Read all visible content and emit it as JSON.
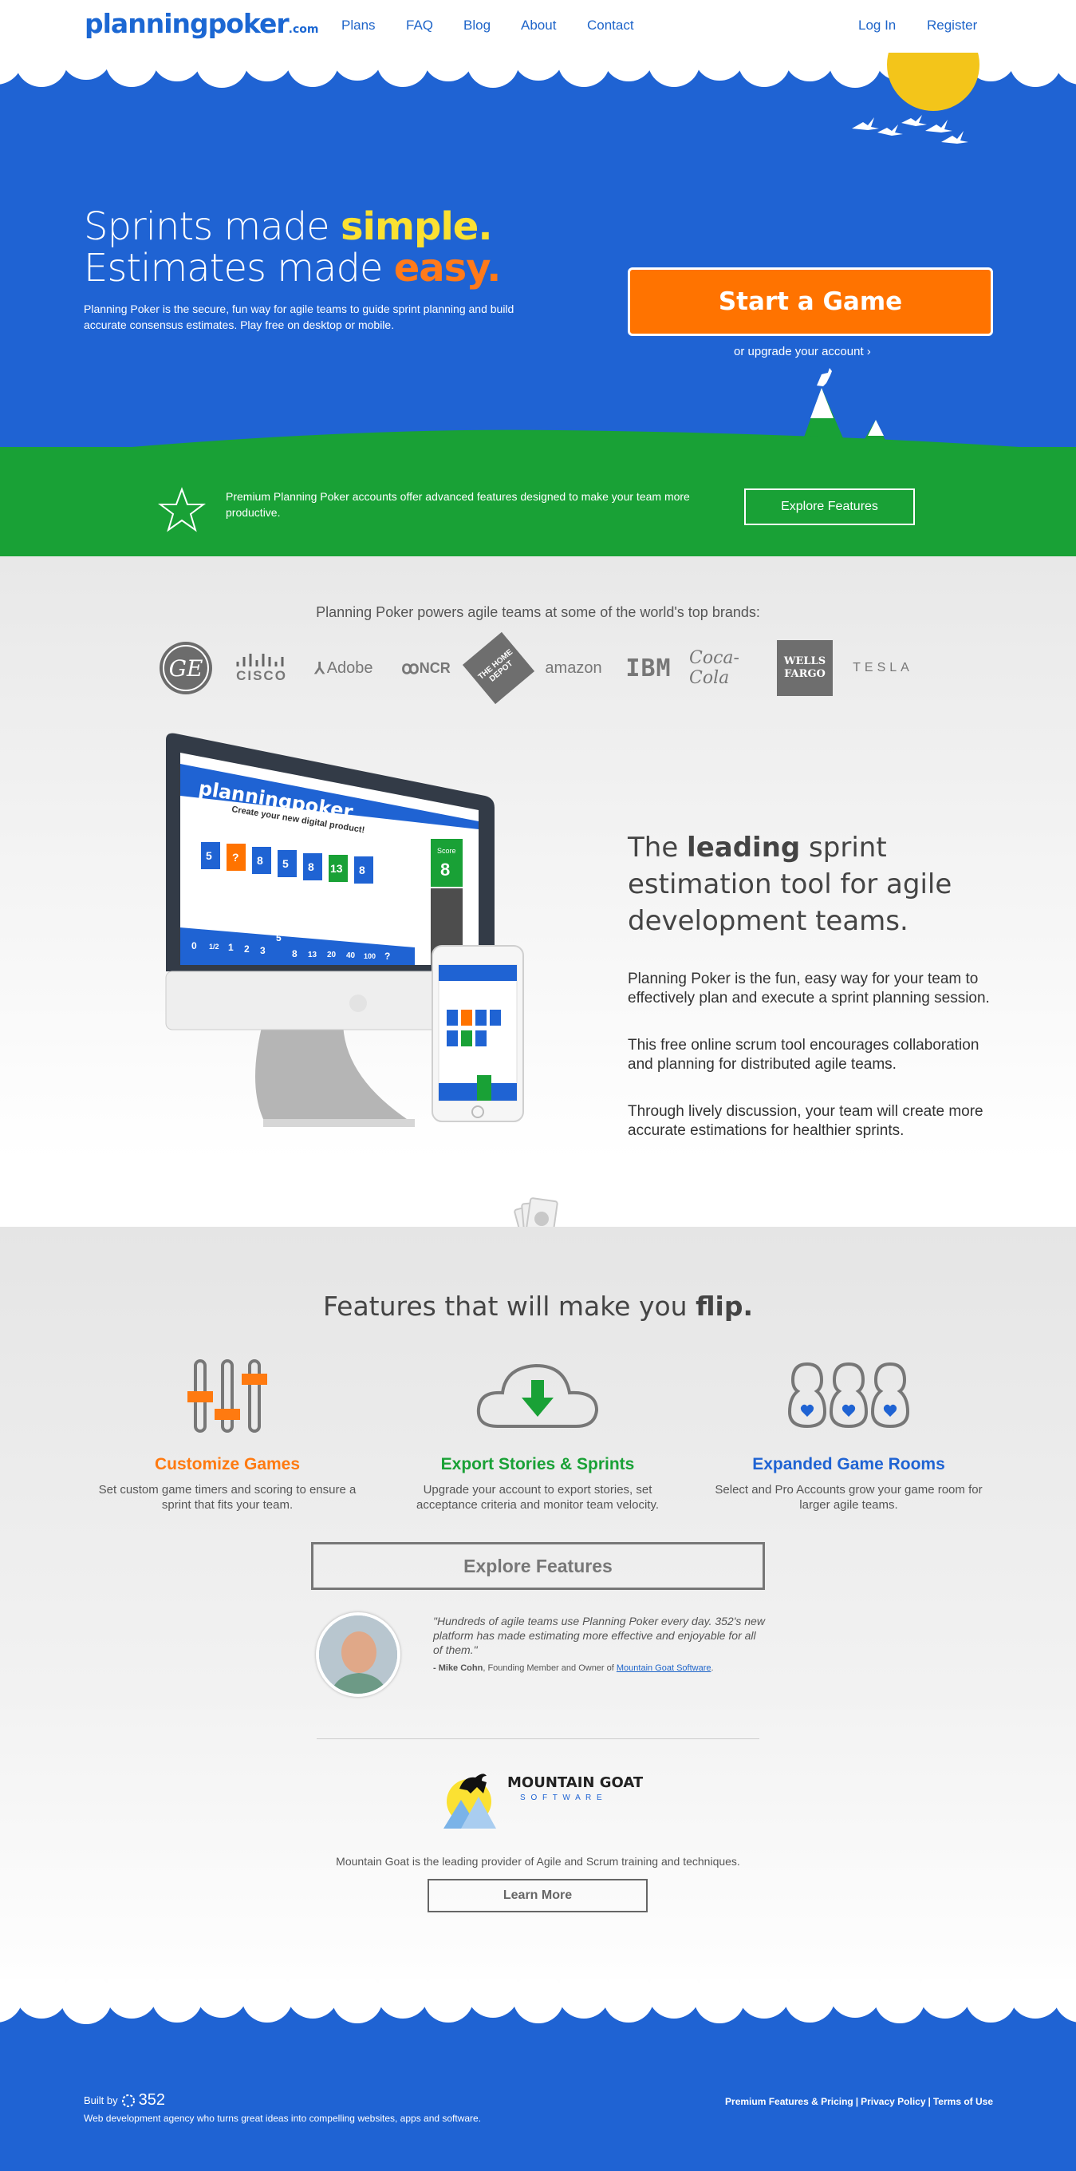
{
  "nav": {
    "logo": "planningpoker",
    "logo_suffix": ".com",
    "links": [
      "Plans",
      "FAQ",
      "Blog",
      "About",
      "Contact"
    ],
    "login": "Log In",
    "register": "Register"
  },
  "hero": {
    "line1_pre": "Sprints made ",
    "line1_em": "simple.",
    "line2_pre": "Estimates made ",
    "line2_em": "easy.",
    "description": "Planning Poker is the secure, fun way for agile teams to guide sprint planning and build accurate consensus estimates. Play free on desktop or mobile.",
    "cta": "Start a Game",
    "upgrade": "or upgrade your account",
    "premium_text": "Premium Planning Poker accounts offer advanced features designed to make your team more productive.",
    "explore_button": "Explore Features"
  },
  "brands": {
    "title": "Planning Poker powers agile teams at some of the world's top brands:",
    "items": [
      "GE",
      "CISCO",
      "Adobe",
      "NCR",
      "THE HOME DEPOT",
      "amazon",
      "IBM",
      "Coca-Cola",
      "WELLS FARGO",
      "TESLA"
    ]
  },
  "mockup": {
    "brand": "planningpoker",
    "task": "Create your new digital product!",
    "cards": [
      "5",
      "?",
      "8",
      "5",
      "8",
      "13",
      "8"
    ],
    "score_label": "Score",
    "score": "8",
    "deck": [
      "0",
      "1/2",
      "1",
      "2",
      "3",
      "5",
      "8",
      "13",
      "20",
      "40",
      "100",
      "?"
    ]
  },
  "intro": {
    "title_pre": "The ",
    "title_bold": "leading",
    "title_post": " sprint estimation tool for agile development teams.",
    "p1": "Planning Poker is the fun, easy way for your team to effectively plan and execute a sprint planning session.",
    "p2": "This free online scrum tool encourages collaboration and planning for distributed agile teams.",
    "p3": "Through lively discussion, your team will create more accurate estimations for healthier sprints."
  },
  "features": {
    "title_pre": "Features that will make you ",
    "title_bold": "flip.",
    "items": [
      {
        "title": "Customize Games",
        "desc": "Set custom game timers and scoring to ensure a sprint that fits your team.",
        "color": "#ff7a10",
        "icon": "sliders-icon"
      },
      {
        "title": "Export Stories & Sprints",
        "desc": "Upgrade your account to export stories, set acceptance criteria and monitor team velocity.",
        "color": "#19a136",
        "icon": "cloud-download-icon"
      },
      {
        "title": "Expanded Game Rooms",
        "desc": "Select and Pro Accounts grow your game room for larger agile teams.",
        "color": "#1f63d3",
        "icon": "users-icon"
      }
    ],
    "explore_button": "Explore Features",
    "quote": "\"Hundreds of agile teams use Planning Poker every day. 352's new platform has made estimating more effective and enjoyable for all of them.\"",
    "author_name": "- Mike Cohn",
    "author_role": ", Founding Member and Owner of ",
    "author_company": "Mountain Goat Software",
    "author_end": ".",
    "mg_name": "MOUNTAIN GOAT",
    "mg_sub": "S O F T W A R E",
    "mg_text": "Mountain Goat is the leading provider of Agile and Scrum training and techniques.",
    "learn_more": "Learn More"
  },
  "footer": {
    "built_by": "Built by",
    "agency_num": "352",
    "agency_desc": "Web development agency who turns great ideas into compelling websites, apps and software.",
    "links": [
      "Premium Features & Pricing",
      "Privacy Policy",
      "Terms of Use"
    ]
  },
  "colors": {
    "blue": "#1f63d3",
    "green": "#19a136",
    "orange": "#ff7300",
    "yellow": "#fbe132"
  }
}
